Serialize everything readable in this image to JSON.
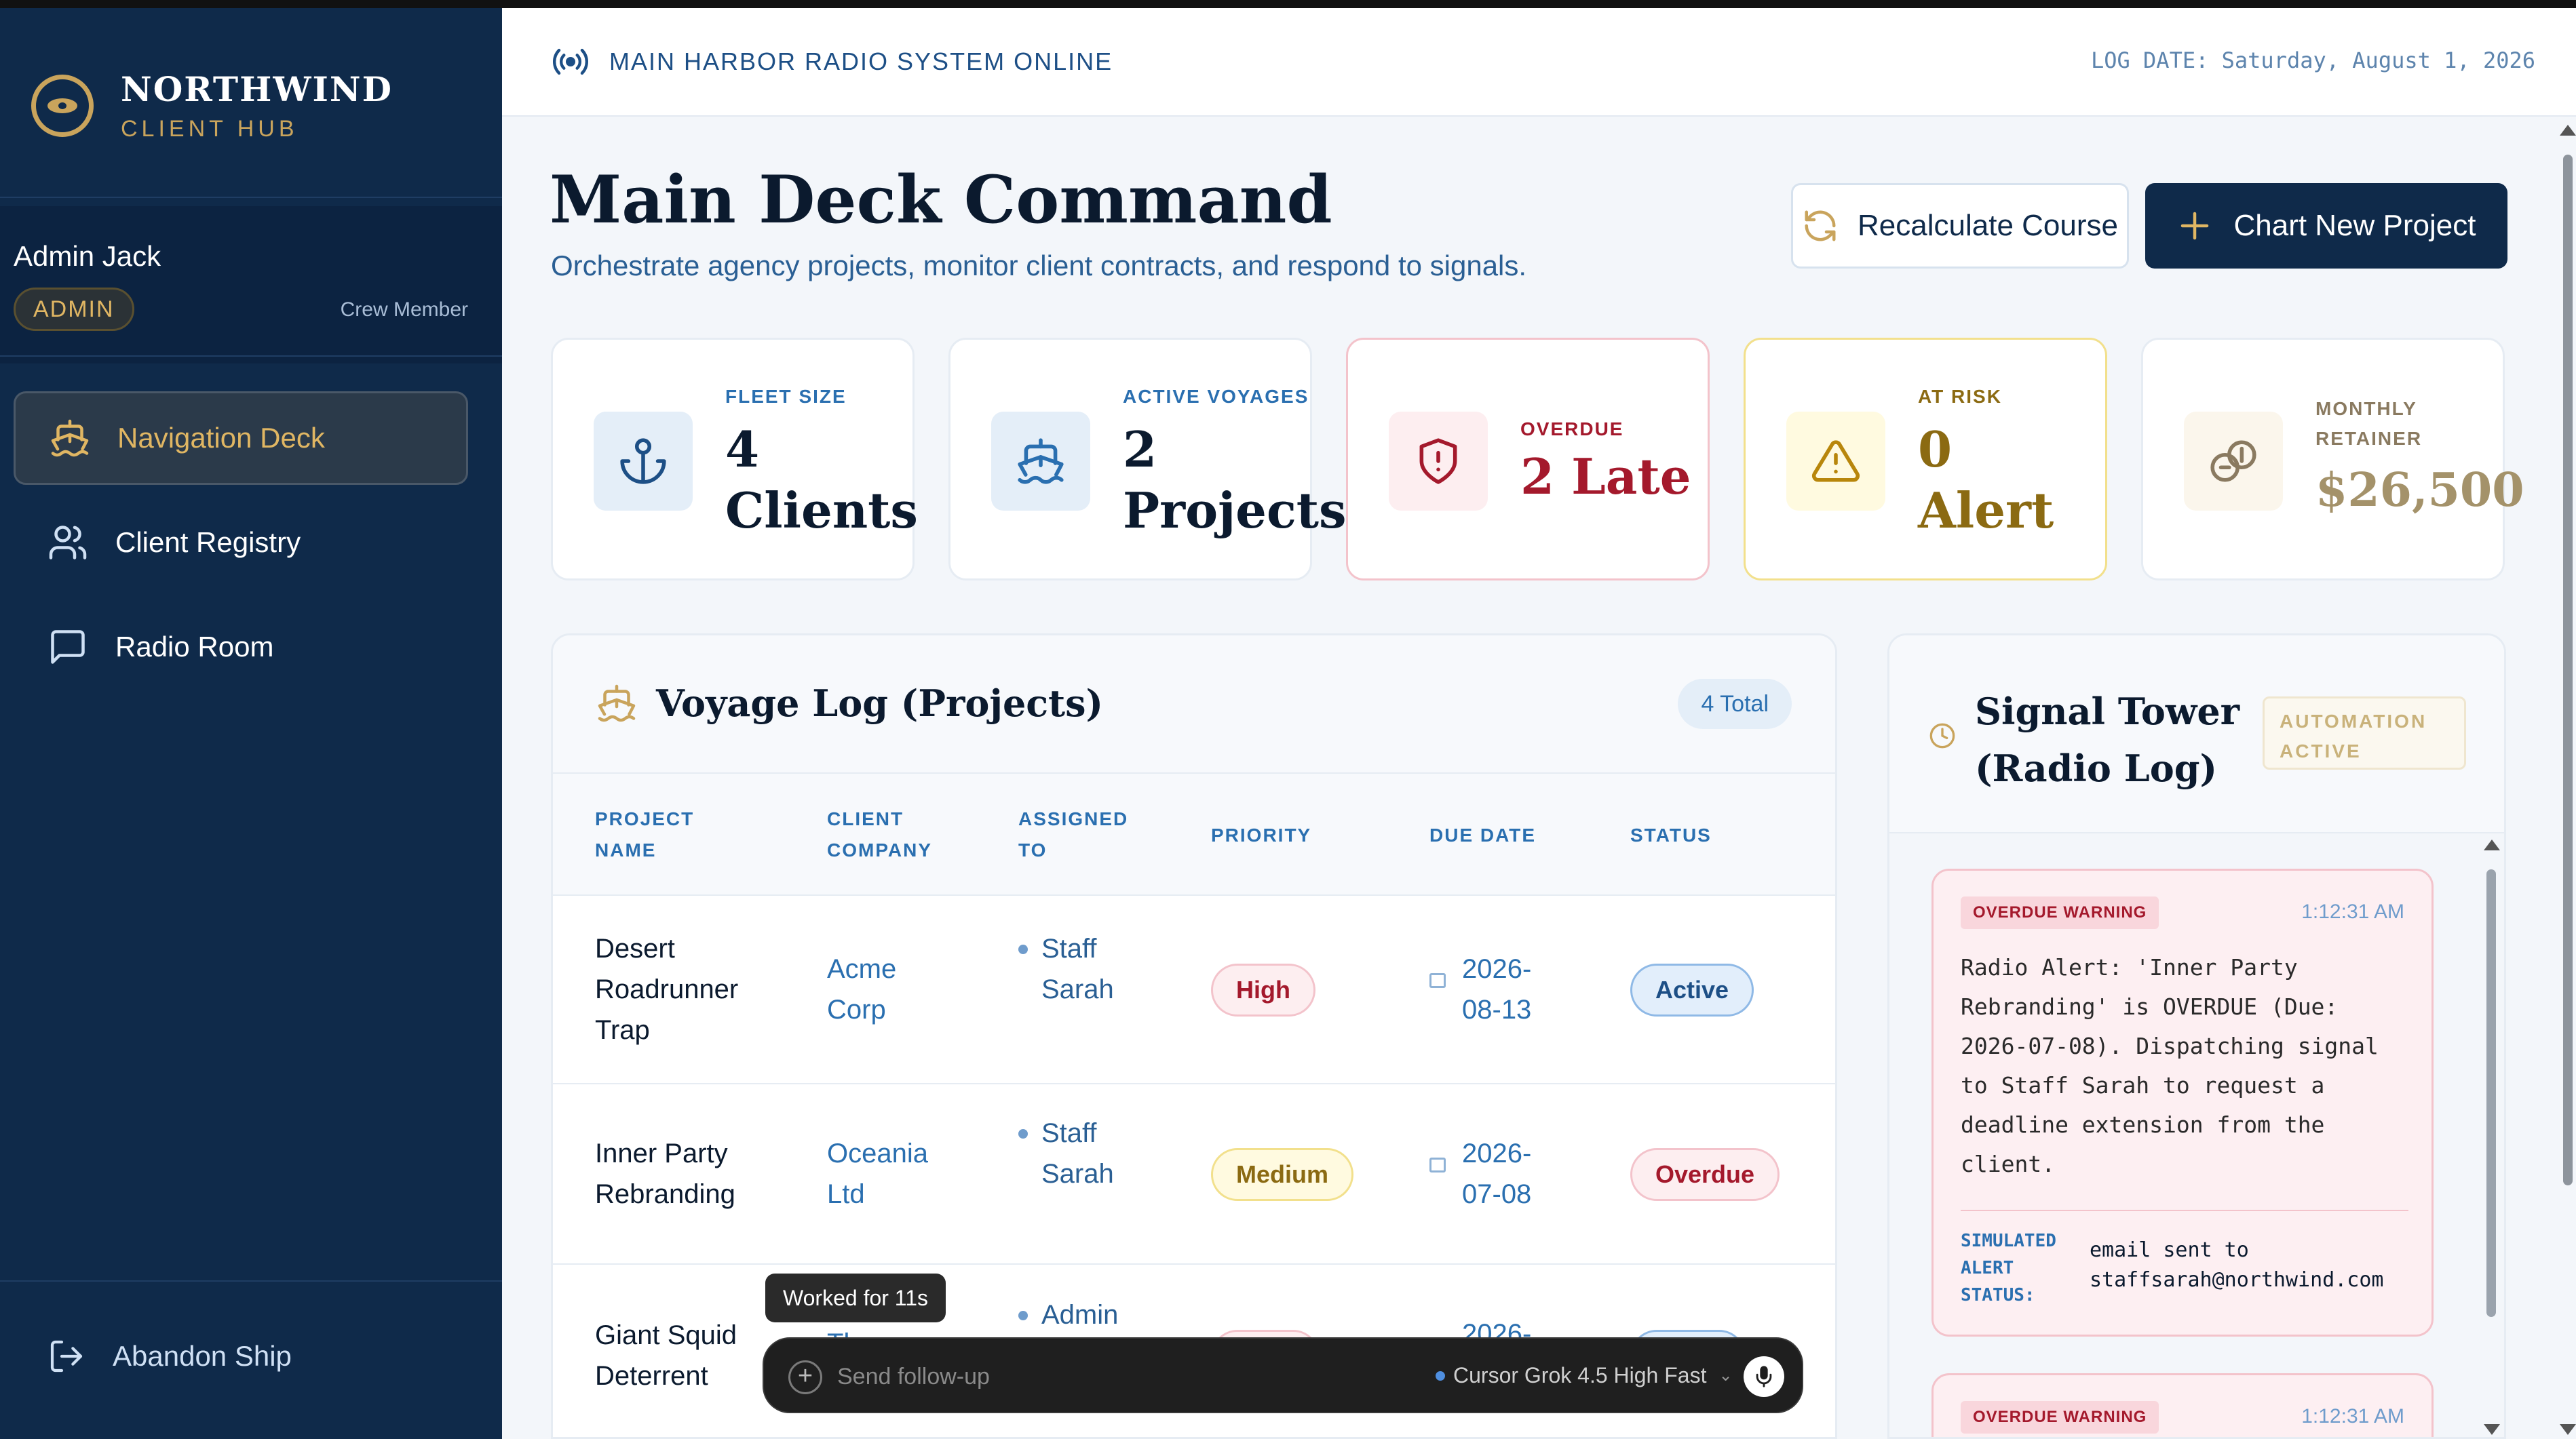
{
  "brand": {
    "name": "NORTHWIND",
    "subtitle": "CLIENT HUB"
  },
  "user": {
    "name": "Admin Jack",
    "role": "ADMIN",
    "label": "Crew Member"
  },
  "nav": {
    "items": [
      {
        "label": "Navigation Deck",
        "icon": "ship-icon",
        "active": true
      },
      {
        "label": "Client Registry",
        "icon": "users-icon",
        "active": false
      },
      {
        "label": "Radio Room",
        "icon": "chat-bubble-icon",
        "active": false
      }
    ],
    "logout": "Abandon Ship"
  },
  "header": {
    "status": "MAIN HARBOR RADIO SYSTEM ONLINE",
    "log_date": "LOG DATE: Saturday, August 1, 2026"
  },
  "main": {
    "title": "Main Deck Command",
    "subtitle": "Orchestrate agency projects, monitor client contracts, and respond to signals.",
    "recalc_button": "Recalculate Course",
    "chart_button": "Chart New Project"
  },
  "stats": [
    {
      "label": "FLEET SIZE",
      "value_line1": "4",
      "value_line2": "Clients",
      "icon": "anchor-icon"
    },
    {
      "label": "ACTIVE VOYAGES",
      "value_line1": "2",
      "value_line2": "Projects",
      "icon": "ship-icon"
    },
    {
      "label": "OVERDUE",
      "value": "2 Late",
      "icon": "shield-alert-icon"
    },
    {
      "label": "AT RISK",
      "value_line1": "0",
      "value_line2": "Alert",
      "icon": "warning-icon"
    },
    {
      "label_line1": "MONTHLY",
      "label_line2": "RETAINER",
      "value": "$26,500",
      "icon": "coins-icon"
    }
  ],
  "voyage": {
    "title": "Voyage Log (Projects)",
    "total": "4 Total",
    "columns": {
      "project_l1": "PROJECT",
      "project_l2": "NAME",
      "client_l1": "CLIENT",
      "client_l2": "COMPANY",
      "assigned_l1": "ASSIGNED",
      "assigned_l2": "TO",
      "priority": "PRIORITY",
      "due": "DUE DATE",
      "status": "STATUS"
    },
    "rows": [
      {
        "name_l1": "Desert",
        "name_l2": "Roadrunner",
        "name_l3": "Trap",
        "client_l1": "Acme",
        "client_l2": "Corp",
        "assigned_l1": "Staff",
        "assigned_l2": "Sarah",
        "priority": "High",
        "due_l1": "2026-",
        "due_l2": "08-13",
        "status": "Active"
      },
      {
        "name_l1": "Inner Party",
        "name_l2": "Rebranding",
        "client_l1": "Oceania",
        "client_l2": "Ltd",
        "assigned_l1": "Staff",
        "assigned_l2": "Sarah",
        "priority": "Medium",
        "due_l1": "2026-",
        "due_l2": "07-08",
        "status": "Overdue"
      },
      {
        "name_l1": "Giant Squid",
        "name_l2": "Deterrent",
        "client_l1": "The",
        "assigned_l1": "Admin",
        "due_l1": "2026-"
      }
    ]
  },
  "signal": {
    "title_l1": "Signal Tower",
    "title_l2": "(Radio Log)",
    "automation_l1": "AUTOMATION",
    "automation_l2": "ACTIVE",
    "alerts": [
      {
        "tag": "OVERDUE WARNING",
        "time": "1:12:31 AM",
        "lines": [
          "Radio Alert: 'Inner Party",
          "Rebranding' is OVERDUE (Due:",
          "2026-07-08). Dispatching signal",
          "to Staff Sarah to request a",
          "deadline extension from the",
          "client."
        ],
        "status_label_l1": "SIMULATED",
        "status_label_l2": "ALERT",
        "status_label_l3": "STATUS:",
        "status_l1": "email sent to",
        "status_l2": "staffsarah@northwind.com"
      },
      {
        "tag": "OVERDUE WARNING",
        "time": "1:12:31 AM"
      }
    ]
  },
  "chat": {
    "tooltip": "Worked for 11s",
    "placeholder": "Send follow-up",
    "model": "Cursor Grok 4.5 High Fast"
  },
  "colors": {
    "sidebar": "#0f2a4a",
    "gold": "#c9a45c",
    "accent_blue": "#2a6fb0",
    "overdue_red": "#a4192c",
    "risk_gold": "#8b6a12"
  }
}
